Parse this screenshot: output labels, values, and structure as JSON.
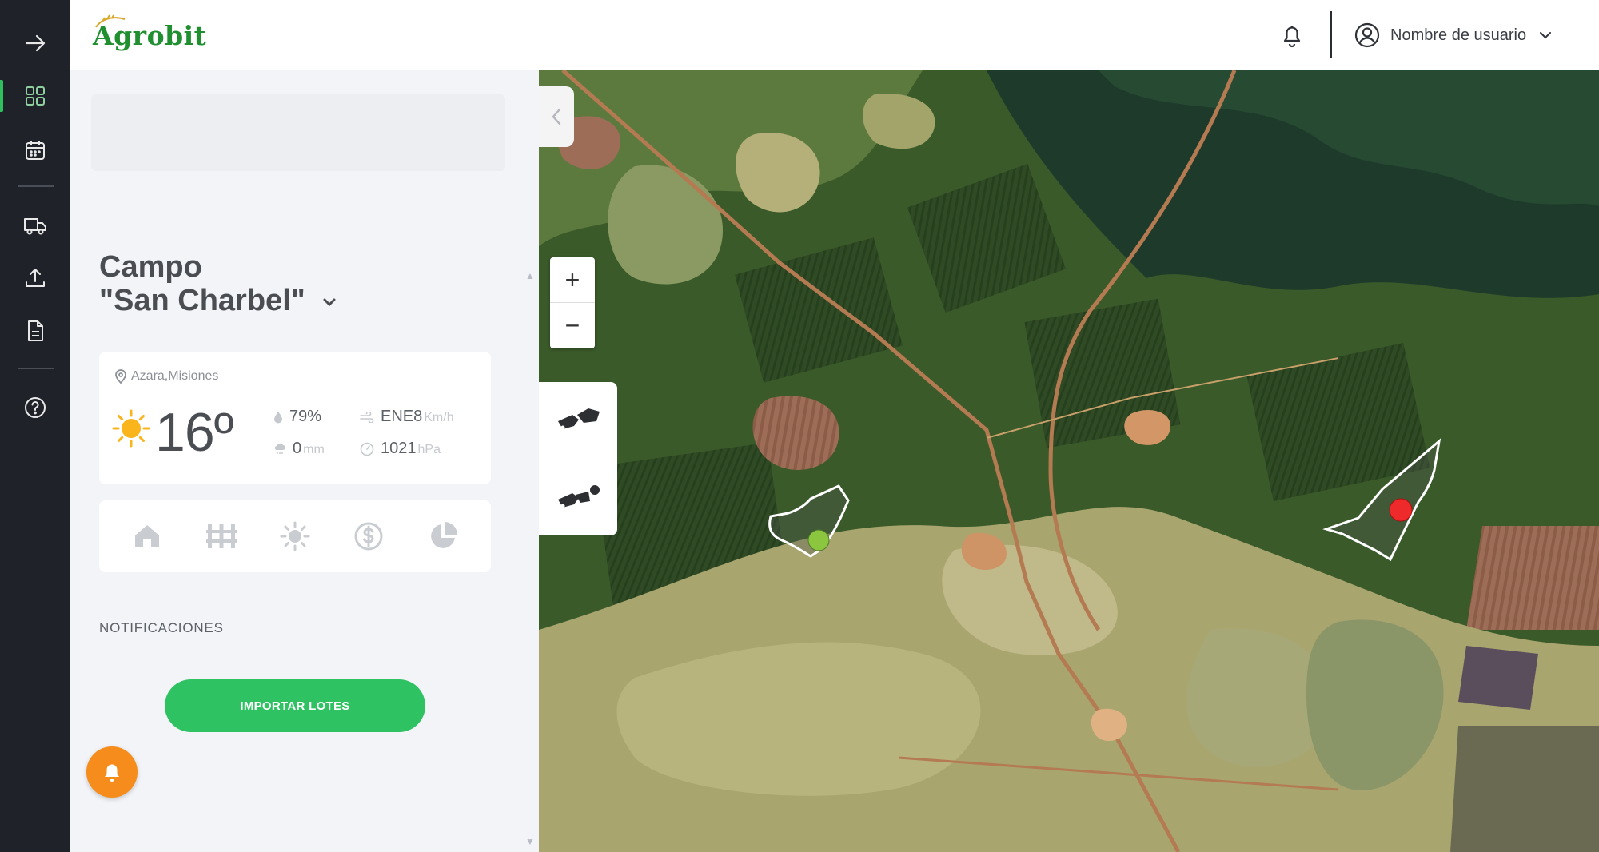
{
  "app": {
    "logo": "Agrobit"
  },
  "header": {
    "username": "Nombre de usuario"
  },
  "rail": {
    "items": [
      {
        "name": "expand-arrow-icon"
      },
      {
        "name": "dashboard-grid-icon",
        "active": true
      },
      {
        "name": "calendar-icon"
      },
      {
        "name": "truck-icon"
      },
      {
        "name": "upload-icon"
      },
      {
        "name": "document-icon"
      },
      {
        "name": "help-icon"
      }
    ]
  },
  "panel": {
    "campo_line1": "Campo",
    "campo_line2": "\"San Charbel\"",
    "weather": {
      "location": "Azara,Misiones",
      "temperature": "16º",
      "humidity": "79%",
      "precip_value": "0",
      "precip_unit": "mm",
      "wind_value": "ENE8",
      "wind_unit": "Km/h",
      "pressure_value": "1021",
      "pressure_unit": "hPa"
    },
    "tools": [
      "home-icon",
      "fence-icon",
      "sun-icon",
      "dollar-icon",
      "pie-chart-icon"
    ],
    "notifications_title": "NOTIFICACIONES",
    "import_button": "IMPORTAR LOTES"
  },
  "map": {
    "zoom_in": "+",
    "zoom_out": "−",
    "lots": [
      {
        "status_color": "#8cc63f"
      },
      {
        "status_color": "#ee2a2a"
      }
    ]
  },
  "colors": {
    "accent": "#2ec262",
    "rail_bg": "#1f2229",
    "fab": "#f58c1b",
    "logo": "#1f8f2f"
  }
}
